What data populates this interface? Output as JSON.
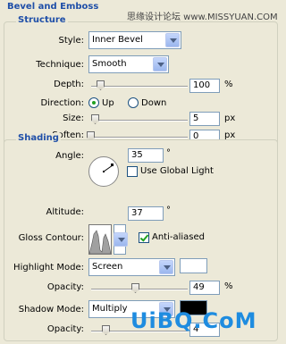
{
  "panel_title": "Bevel and Emboss",
  "watermark_top": "思缘设计论坛 www.MISSYUAN.COM",
  "watermark_bottom": "UiBQ.CoM",
  "structure": {
    "legend": "Structure",
    "style_label": "Style:",
    "style_value": "Inner Bevel",
    "technique_label": "Technique:",
    "technique_value": "Smooth",
    "depth_label": "Depth:",
    "depth_value": "100",
    "depth_unit": "%",
    "direction_label": "Direction:",
    "direction_up": "Up",
    "direction_down": "Down",
    "direction_selected": "Up",
    "size_label": "Size:",
    "size_value": "5",
    "size_unit": "px",
    "soften_label": "Soften:",
    "soften_value": "0",
    "soften_unit": "px"
  },
  "shading": {
    "legend": "Shading",
    "angle_label": "Angle:",
    "angle_value": "35",
    "angle_unit": "°",
    "use_global_light": "Use Global Light",
    "use_global_light_checked": false,
    "altitude_label": "Altitude:",
    "altitude_value": "37",
    "altitude_unit": "°",
    "gloss_contour_label": "Gloss Contour:",
    "anti_aliased": "Anti-aliased",
    "anti_aliased_checked": true,
    "highlight_mode_label": "Highlight Mode:",
    "highlight_mode_value": "Screen",
    "highlight_color": "#ffffff",
    "highlight_opacity_label": "Opacity:",
    "highlight_opacity_value": "49",
    "highlight_opacity_unit": "%",
    "shadow_mode_label": "Shadow Mode:",
    "shadow_mode_value": "Multiply",
    "shadow_color": "#000000",
    "shadow_opacity_label": "Opacity:",
    "shadow_opacity_value": "4"
  }
}
